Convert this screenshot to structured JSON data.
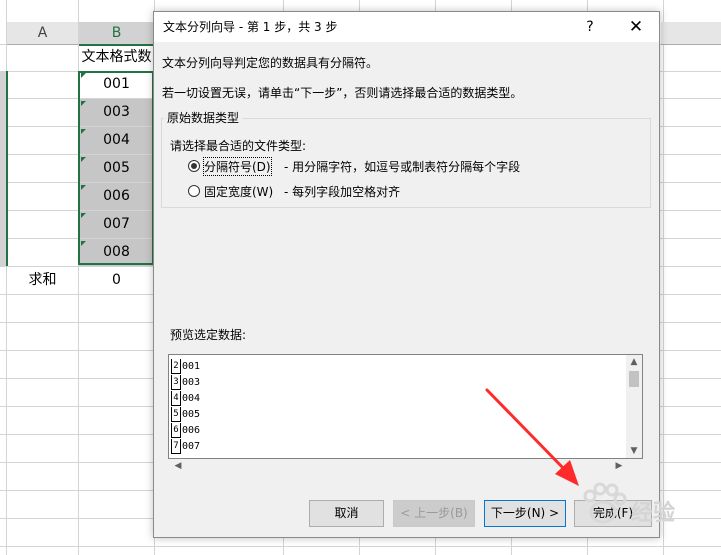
{
  "spreadsheet": {
    "columns": [
      "A",
      "B"
    ],
    "header_cell": "文本格式数",
    "values": [
      "001",
      "003",
      "004",
      "005",
      "006",
      "007",
      "008"
    ],
    "sum_label": "求和",
    "sum_value": "0"
  },
  "dialog": {
    "title": "文本分列向导 - 第 1 步，共 3 步",
    "help_glyph": "?",
    "close_glyph": "✕",
    "intro": "文本分列向导判定您的数据具有分隔符。",
    "instruction": "若一切设置无误，请单击“下一步”，否则请选择最合适的数据类型。",
    "group_title": "原始数据类型",
    "choose_label": "请选择最合适的文件类型:",
    "options": [
      {
        "label": "分隔符号(D)",
        "desc": "- 用分隔字符，如逗号或制表符分隔每个字段",
        "checked": true
      },
      {
        "label": "固定宽度(W)",
        "desc": "- 每列字段加空格对齐",
        "checked": false
      }
    ],
    "preview_label": "预览选定数据:",
    "preview_rows": [
      {
        "num": "2",
        "text": "001"
      },
      {
        "num": "3",
        "text": "003"
      },
      {
        "num": "4",
        "text": "004"
      },
      {
        "num": "5",
        "text": "005"
      },
      {
        "num": "6",
        "text": "006"
      },
      {
        "num": "7",
        "text": "007"
      }
    ],
    "buttons": {
      "cancel": "取消",
      "back": "< 上一步(B)",
      "next": "下一步(N) >",
      "finish": "完成(F)"
    }
  },
  "watermark": {
    "text": "经验"
  },
  "colors": {
    "accent": "#217346",
    "arrow": "#ff2a2a",
    "default_button": "#0078d7"
  }
}
